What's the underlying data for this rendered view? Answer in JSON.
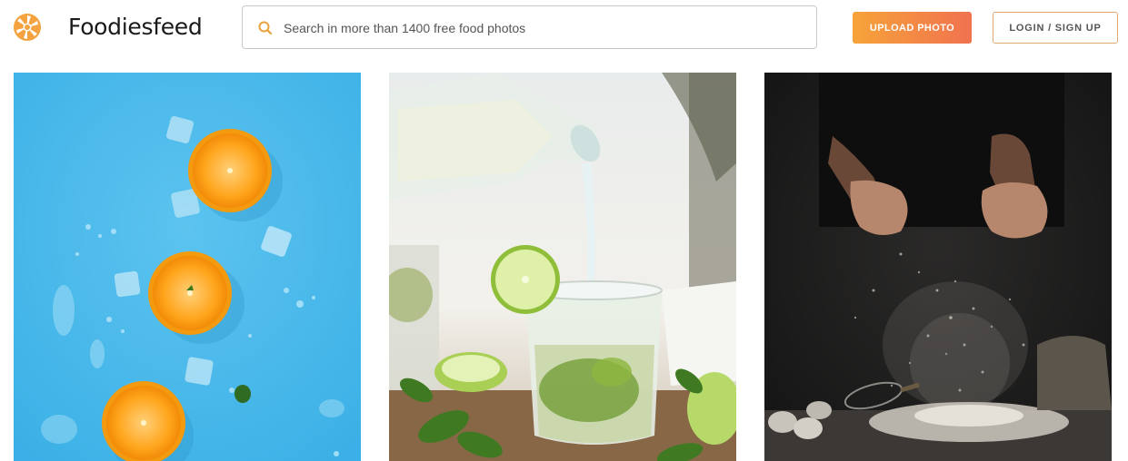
{
  "header": {
    "brand_name": "Foodiesfeed",
    "logo_icon": "aperture-logo-icon",
    "search": {
      "placeholder": "Search in more than 1400 free food photos",
      "value": "",
      "icon": "search-icon"
    },
    "upload_label": "UPLOAD PHOTO",
    "login_label": "LOGIN / SIGN UP"
  },
  "colors": {
    "accent_orange": "#f7a33a",
    "accent_coral": "#f0724f",
    "login_border": "#e2a872",
    "logo_orange": "#f4a340"
  },
  "gallery": {
    "photos": [
      {
        "subject": "orange-slices-on-blue"
      },
      {
        "subject": "mojito-being-poured"
      },
      {
        "subject": "flour-dusting-hands-dark"
      }
    ]
  }
}
